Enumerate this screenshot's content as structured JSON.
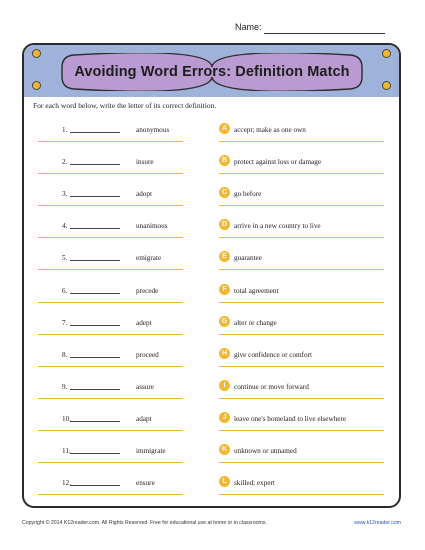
{
  "name_label": "Name:",
  "title": "Avoiding Word Errors: Definition Match",
  "instructions": "For each word below, write the letter of its correct definition.",
  "items": [
    {
      "num": "1.",
      "word": "anonymous"
    },
    {
      "num": "2.",
      "word": "insure"
    },
    {
      "num": "3.",
      "word": "adopt"
    },
    {
      "num": "4.",
      "word": "unanimous"
    },
    {
      "num": "5.",
      "word": "emigrate"
    },
    {
      "num": "6.",
      "word": "precede"
    },
    {
      "num": "7.",
      "word": "adept"
    },
    {
      "num": "8.",
      "word": "proceed"
    },
    {
      "num": "9.",
      "word": "assure"
    },
    {
      "num": "10.",
      "word": "adapt"
    },
    {
      "num": "11.",
      "word": "immigrate"
    },
    {
      "num": "12.",
      "word": "ensure"
    }
  ],
  "definitions": [
    {
      "letter": "A",
      "text": "accept; make as one own"
    },
    {
      "letter": "B",
      "text": "protect against loss or damage"
    },
    {
      "letter": "C",
      "text": "go before"
    },
    {
      "letter": "D",
      "text": "arrive in a new country to live"
    },
    {
      "letter": "E",
      "text": "guarantee"
    },
    {
      "letter": "F",
      "text": "total agreement"
    },
    {
      "letter": "G",
      "text": "alter or change"
    },
    {
      "letter": "H",
      "text": "give confidence or comfort"
    },
    {
      "letter": "I",
      "text": "continue or move forward"
    },
    {
      "letter": "J",
      "text": "leave one's homeland to live elsewhere"
    },
    {
      "letter": "K",
      "text": "unknown or unnamed"
    },
    {
      "letter": "L",
      "text": "skilled; expert"
    }
  ],
  "footer_left": "Copyright © 2014  K12reader.com. All Rights Reserved. Free for educational use at home or in classrooms.",
  "footer_right": "www.k12reader.com",
  "colors": {
    "accent": "#f4b730",
    "band": "#9fb2da",
    "banner": "#b99ad1",
    "border": "#2b2b2b"
  }
}
